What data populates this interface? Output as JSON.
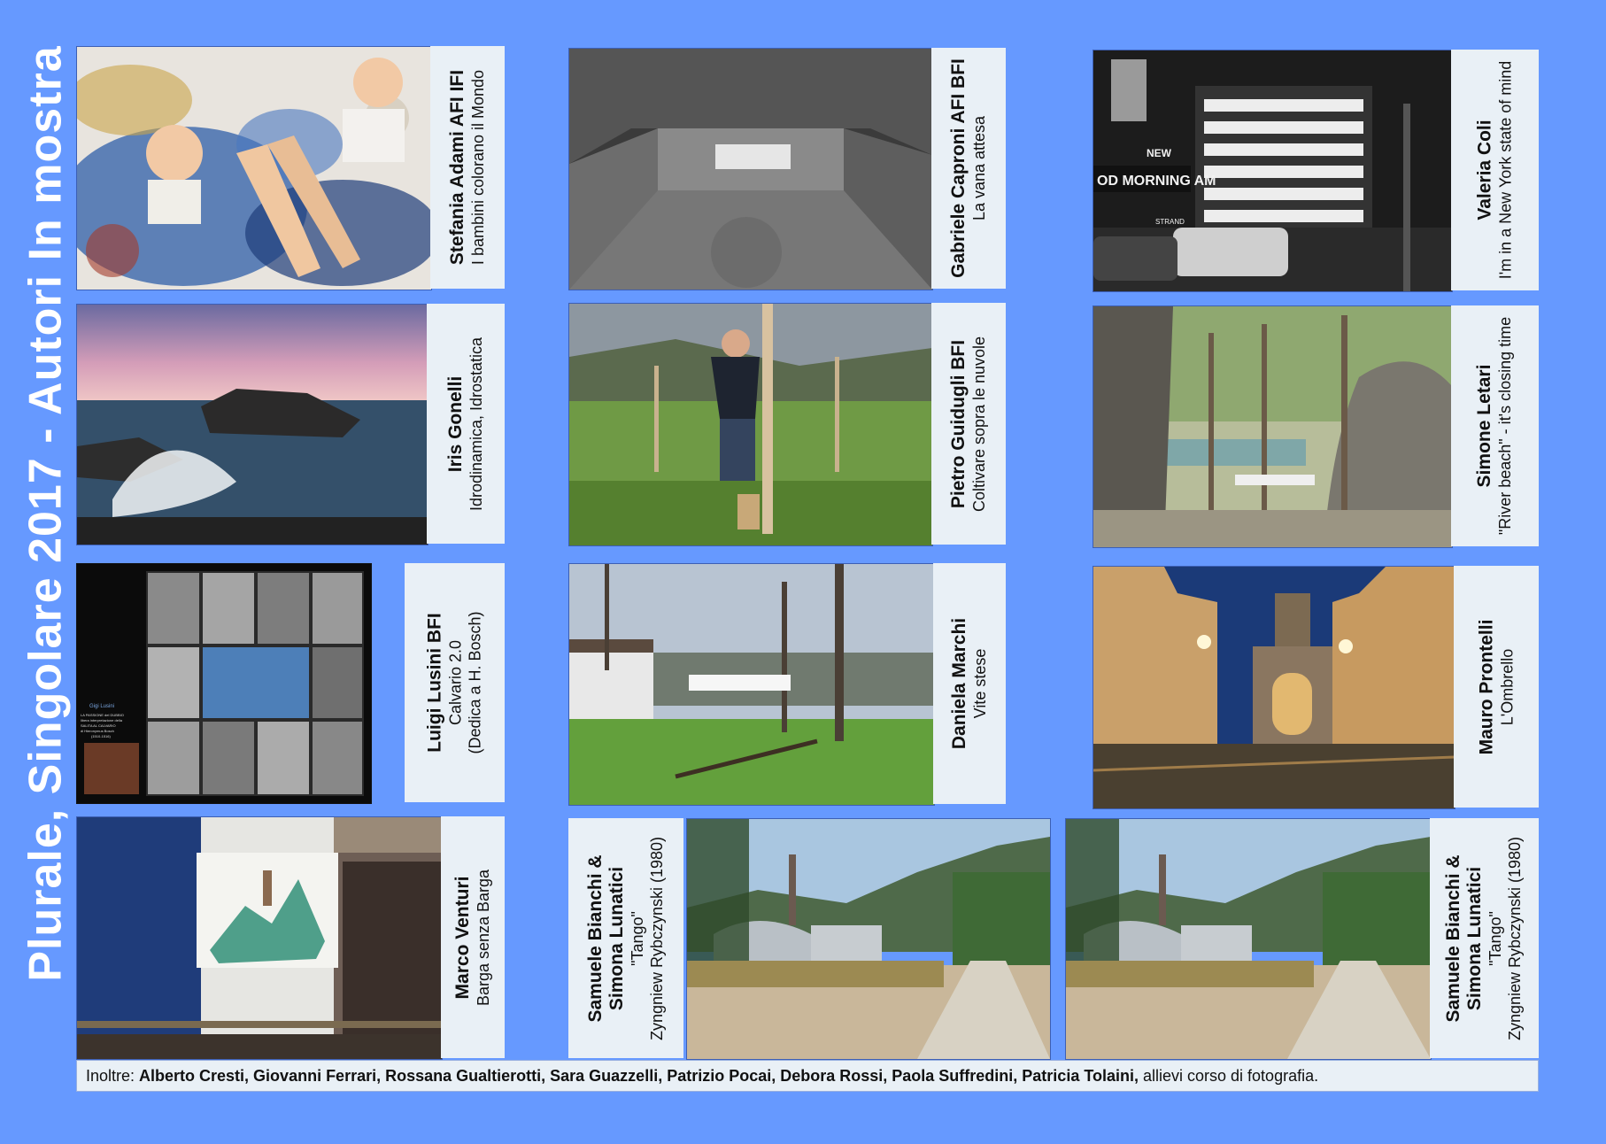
{
  "page_title": "Plurale, Singolare 2017 - Autori In mostra",
  "tiles": [
    {
      "name": "Stefania Adami AFI IFI",
      "title": "I bambini colorano il Mondo"
    },
    {
      "name": "Gabriele Caproni AFI BFI",
      "title": "La vana attesa"
    },
    {
      "name": "Valeria Coli",
      "title": "I'm in a New York state of mind"
    },
    {
      "name": "Iris Gonelli",
      "title": "Idrodinamica, Idrostatica"
    },
    {
      "name": "Pietro Guidugli BFI",
      "title": "Coltivare sopra le nuvole"
    },
    {
      "name": "Simone Letari",
      "title": "\"River beach\" - it's closing time"
    },
    {
      "name": "Luigi Lusini BFI",
      "title": "Calvario 2.0",
      "title2": "(Dedica a H. Bosch)"
    },
    {
      "name": "Daniela Marchi",
      "title": "Vite stese"
    },
    {
      "name": "Mauro Prontelli",
      "title": "L'Ombrello"
    },
    {
      "name": "Marco Venturi",
      "title": "Barga senza Barga"
    },
    {
      "name": "Samuele Bianchi &",
      "name2": "Simona Lunatici",
      "title": "\"Tango\"",
      "title2": "Zyngniew Rybczynski (1980)"
    },
    {
      "name": "Samuele Bianchi &",
      "name2": "Simona Lunatici",
      "title": "\"Tango\"",
      "title2": "Zyngniew Rybczynski (1980)"
    }
  ],
  "poster_text": {
    "author": "Gigi Lusini",
    "line1": "LA PASSIONE del DUBBIO",
    "line2": "libera interpretazione della",
    "line3": "SALITA AL CALVARIO",
    "line4": "di Hieronymus Bosch",
    "line5": "(1510-1516)"
  },
  "photo_text": {
    "good_morning": "OD MORNING AM",
    "new": "NEW",
    "strand": "STRAND"
  },
  "footer": {
    "prefix": "Inoltre: ",
    "names": "Alberto Cresti, Giovanni Ferrari, Rossana Gualtierotti,  Sara Guazzelli, Patrizio Pocai, Debora Rossi, Paola Suffredini, Patricia Tolaini,",
    "suffix": " allievi corso di fotografia."
  }
}
